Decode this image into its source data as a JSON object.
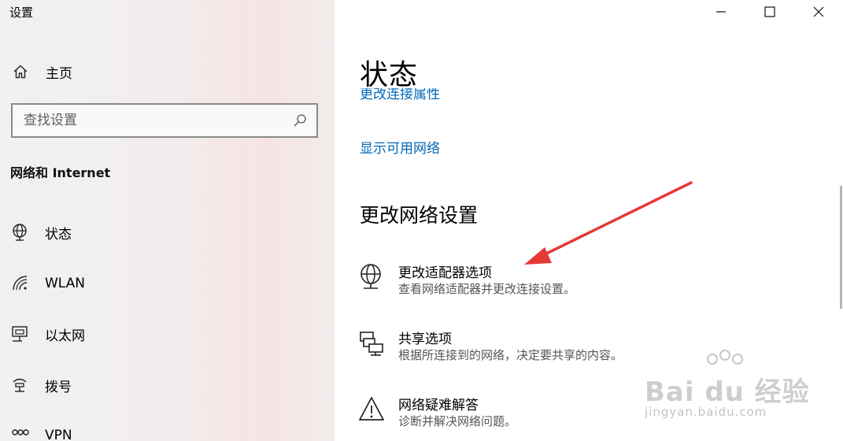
{
  "window": {
    "title": "设置",
    "controls": {
      "minimize": "minimize-icon",
      "maximize": "maximize-icon",
      "close": "close-icon"
    }
  },
  "sidebar": {
    "home_label": "主页",
    "search_placeholder": "查找设置",
    "section_heading": "网络和 Internet",
    "items": [
      {
        "label": "状态",
        "icon": "globe-icon"
      },
      {
        "label": "WLAN",
        "icon": "wifi-icon"
      },
      {
        "label": "以太网",
        "icon": "ethernet-icon"
      },
      {
        "label": "拨号",
        "icon": "dialup-icon"
      },
      {
        "label": "VPN",
        "icon": "vpn-icon"
      }
    ]
  },
  "main": {
    "title": "状态",
    "clipped_link": "更改连接属性",
    "show_networks_link": "显示可用网络",
    "section_heading": "更改网络设置",
    "options": [
      {
        "title": "更改适配器选项",
        "desc": "查看网络适配器并更改连接设置。",
        "icon": "adapter-icon"
      },
      {
        "title": "共享选项",
        "desc": "根据所连接到的网络，决定要共享的内容。",
        "icon": "sharing-icon"
      },
      {
        "title": "网络疑难解答",
        "desc": "诊断并解决网络问题。",
        "icon": "warning-icon"
      }
    ]
  },
  "watermark": {
    "brand": "Bai du 经验",
    "url": "jingyan.baidu.com"
  },
  "colors": {
    "link": "#0067b8",
    "arrow": "#e53935",
    "sidebar_bg": "#f2eeee"
  }
}
